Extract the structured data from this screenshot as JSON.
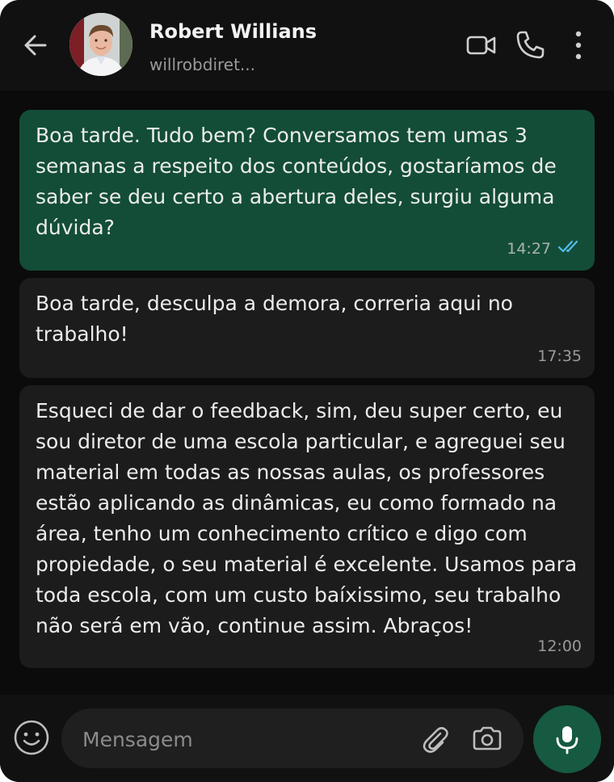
{
  "header": {
    "contact_name": "Robert Willians",
    "contact_subtitle": "willrobdiret...",
    "icons": [
      "back-arrow-icon",
      "avatar",
      "video-call-icon",
      "voice-call-icon",
      "more-options-icon"
    ]
  },
  "messages": [
    {
      "direction": "outgoing",
      "text": "Boa tarde. Tudo bem? Conversamos tem umas 3 semanas a respeito dos conteúdos, gostaríamos de saber se deu certo a abertura deles, surgiu alguma dúvida?",
      "time": "14:27",
      "status": "read"
    },
    {
      "direction": "incoming",
      "text": "Boa tarde, desculpa a demora, correria aqui no trabalho!",
      "time": "17:35"
    },
    {
      "direction": "incoming",
      "text": "Esqueci de dar o feedback, sim, deu super certo, eu sou diretor de uma escola particular, e agreguei seu material em todas as nossas aulas, os professores estão aplicando as dinâmicas, eu como formado na área, tenho um conhecimento crítico e digo com propiedade, o seu material é excelente. Usamos para toda escola, com um custo baíxissimo, seu trabalho não será em vão, continue assim. Abraços!",
      "time": "12:00"
    }
  ],
  "composer": {
    "placeholder": "Mensagem",
    "value": "",
    "icons": [
      "emoji-icon",
      "attach-icon",
      "camera-icon",
      "mic-icon"
    ]
  },
  "colors": {
    "outgoing_bubble": "#134d37",
    "incoming_bubble": "#1c1c1c",
    "read_ticks": "#53bdeb",
    "mic_button": "#165a41"
  }
}
